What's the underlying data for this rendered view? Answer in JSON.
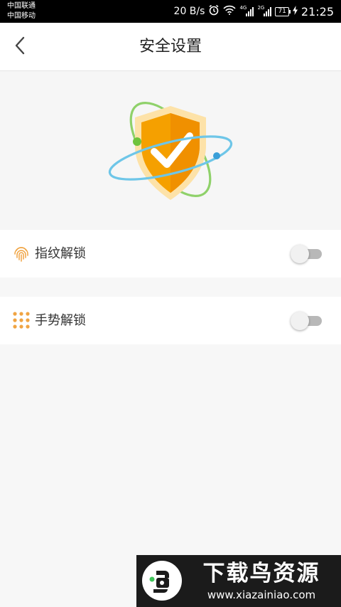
{
  "status_bar": {
    "carrier_1": "中国联通",
    "carrier_2": "中国移动",
    "network_speed": "20 B/s",
    "signal_1_tag": "4G",
    "signal_2_tag": "2G",
    "battery_level": "71",
    "time": "21:25"
  },
  "header": {
    "title": "安全设置",
    "back_icon": "chevron-left-icon"
  },
  "hero": {
    "icon": "security-shield-icon",
    "colors": {
      "shield": "#f5a000",
      "orbit_green": "#8fd16a",
      "orbit_blue": "#6ec6e8"
    }
  },
  "settings": {
    "fingerprint_unlock": {
      "label": "指纹解锁",
      "icon": "fingerprint-icon",
      "enabled": false
    },
    "gesture_unlock": {
      "label": "手势解锁",
      "icon": "gesture-dots-icon",
      "enabled": false
    }
  },
  "watermark": {
    "title": "下载鸟资源",
    "url": "www.xiazainiao.com"
  },
  "colors": {
    "accent": "#f5a000",
    "background": "#f7f7f7",
    "toggle_off": "#b8b8b8"
  }
}
